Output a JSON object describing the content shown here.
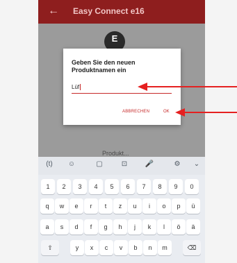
{
  "appbar": {
    "title": "Easy Connect e16",
    "back_icon": "arrow-left-icon"
  },
  "logo": {
    "glyph": "E"
  },
  "background_text": "Produkt...",
  "dialog": {
    "heading": "Geben Sie den neuen Produktnamen ein",
    "input_value": "Lüf",
    "cancel_label": "ABBRECHEN",
    "ok_label": "OK"
  },
  "keyboard": {
    "tools": [
      "(t)",
      "☺",
      "▢",
      "⊡",
      "🎤",
      "⚙",
      "⌄"
    ],
    "row_numbers": [
      "1",
      "2",
      "3",
      "4",
      "5",
      "6",
      "7",
      "8",
      "9",
      "0"
    ],
    "row_1": [
      "q",
      "w",
      "e",
      "r",
      "t",
      "z",
      "u",
      "i",
      "o",
      "p",
      "ü"
    ],
    "row_2": [
      "a",
      "s",
      "d",
      "f",
      "g",
      "h",
      "j",
      "k",
      "l",
      "ö",
      "ä"
    ],
    "row_3": [
      "y",
      "x",
      "c",
      "v",
      "b",
      "n",
      "m"
    ],
    "shift_label": "⇧",
    "backspace_label": "⌫"
  },
  "colors": {
    "appbar": "#8e1e1e",
    "accent": "#c62828",
    "annotation_arrow": "#e52020"
  }
}
